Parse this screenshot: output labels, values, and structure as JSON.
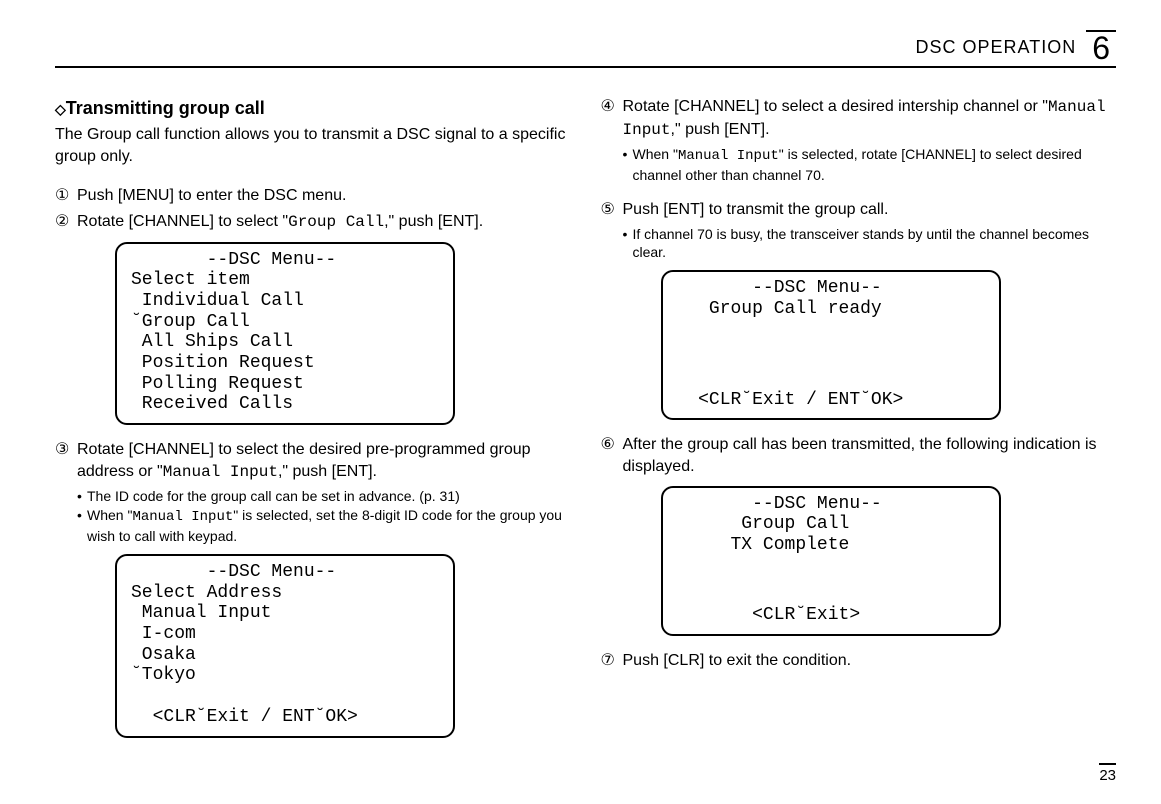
{
  "header": {
    "title": "DSC OPERATION",
    "chapter": "6"
  },
  "left": {
    "section_marker": "◇",
    "section_title": "Transmitting group call",
    "intro": "The Group call function allows you to transmit a DSC signal to a specific group only.",
    "step1_num": "①",
    "step1": "Push [MENU] to enter the DSC menu.",
    "step2_num": "②",
    "step2_a": "Rotate [CHANNEL] to select \"",
    "step2_code": "Group Call",
    "step2_b": ",\" push [ENT].",
    "lcd1": "       --DSC Menu--\nSelect item\n Individual Call\n˘Group Call\n All Ships Call\n Position Request\n Polling Request\n Received Calls",
    "step3_num": "③",
    "step3_a": "Rotate [CHANNEL] to select the desired pre-programmed group address or \"",
    "step3_code": "Manual Input",
    "step3_b": ",\" push [ENT].",
    "step3_sub1": "The ID code for the group call can be set in advance. (p. 31)",
    "step3_sub2_a": "When \"",
    "step3_sub2_code": "Manual Input",
    "step3_sub2_b": "\" is selected, set the 8-digit ID code for the group you wish to call with keypad.",
    "lcd2": "       --DSC Menu--\nSelect Address\n Manual Input\n I-com\n Osaka\n˘Tokyo\n\n  <CLR˘Exit / ENT˘OK>"
  },
  "right": {
    "step4_num": "④",
    "step4_a": "Rotate [CHANNEL] to select a desired intership channel or \"",
    "step4_code": "Manual Input",
    "step4_b": ",\" push [ENT].",
    "step4_sub_a": "When \"",
    "step4_sub_code": "Manual Input",
    "step4_sub_b": "\" is selected, rotate [CHANNEL] to select desired channel other than channel 70.",
    "step5_num": "⑤",
    "step5": "Push [ENT] to transmit the group call.",
    "step5_sub": "If channel 70 is busy, the transceiver stands by until the channel becomes clear.",
    "lcd3_top": "       --DSC Menu--\n   Group Call ready",
    "lcd3_bottom": "  <CLR˘Exit / ENT˘OK>",
    "step6_num": "⑥",
    "step6": "After the group call has been transmitted, the following indication is displayed.",
    "lcd4_top": "       --DSC Menu--\n      Group Call\n     TX Complete",
    "lcd4_bottom": "       <CLR˘Exit>",
    "step7_num": "⑦",
    "step7": "Push [CLR] to exit the condition."
  },
  "page_number": "23"
}
